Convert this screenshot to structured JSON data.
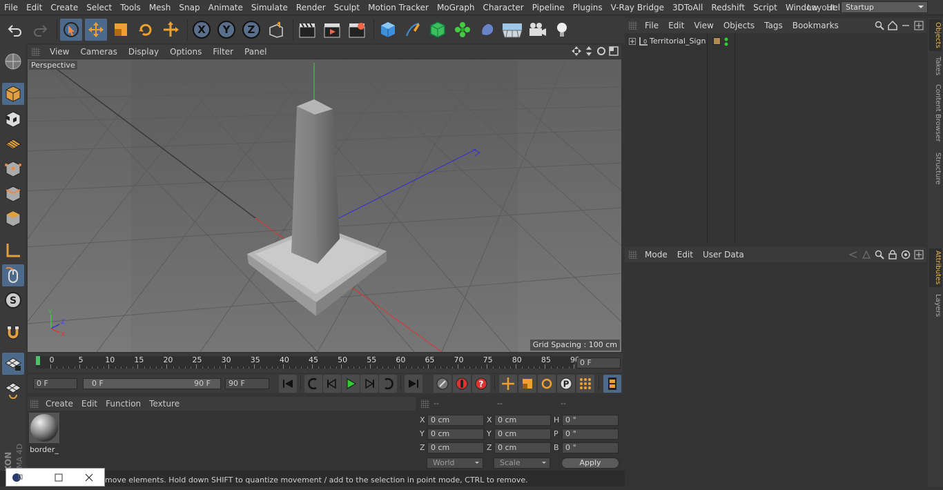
{
  "menu": [
    "File",
    "Edit",
    "Create",
    "Select",
    "Tools",
    "Mesh",
    "Snap",
    "Animate",
    "Simulate",
    "Render",
    "Sculpt",
    "Motion Tracker",
    "MoGraph",
    "Character",
    "Pipeline",
    "Plugins",
    "V-Ray Bridge",
    "3DToAll",
    "Redshift",
    "Script",
    "Window",
    "Help"
  ],
  "layout": {
    "label": "Layout:",
    "value": "Startup"
  },
  "viewport": {
    "menu": [
      "View",
      "Cameras",
      "Display",
      "Options",
      "Filter",
      "Panel"
    ],
    "name": "Perspective",
    "grid_spacing": "Grid Spacing : 100 cm",
    "axis": {
      "x": "X",
      "y": "Y",
      "z": "Z"
    }
  },
  "timeline": {
    "ticks": [
      "0",
      "5",
      "10",
      "15",
      "20",
      "25",
      "30",
      "35",
      "40",
      "45",
      "50",
      "55",
      "60",
      "65",
      "70",
      "75",
      "80",
      "85",
      "90"
    ],
    "current_frame": "0 F",
    "start_field": "0 F",
    "range_start": "0 F",
    "range_end": "90 F",
    "end_field": "90 F"
  },
  "material": {
    "menu": [
      "Create",
      "Edit",
      "Function",
      "Texture"
    ],
    "items": [
      {
        "name": "border_"
      }
    ]
  },
  "coords": {
    "headers": [
      "--",
      "--",
      "--"
    ],
    "pos": {
      "x": "0 cm",
      "y": "0 cm",
      "z": "0 cm"
    },
    "size": {
      "x": "0 cm",
      "y": "0 cm",
      "z": "0 cm"
    },
    "rot": {
      "h": "0 °",
      "p": "0 °",
      "b": "0 °"
    },
    "labels": {
      "x": "X",
      "y": "Y",
      "z": "Z",
      "h": "H",
      "p": "P",
      "b": "B"
    },
    "world": "World",
    "scale": "Scale",
    "apply": "Apply"
  },
  "status": "move elements. Hold down SHIFT to quantize movement / add to the selection in point mode, CTRL to remove.",
  "objects": {
    "menu": [
      "File",
      "Edit",
      "View",
      "Objects",
      "Tags",
      "Bookmarks"
    ],
    "items": [
      {
        "name": "Territorial_Sign"
      }
    ]
  },
  "attributes": {
    "menu": [
      "Mode",
      "Edit",
      "User Data"
    ]
  },
  "right_tabs": [
    "Objects",
    "Takes",
    "Content Browser",
    "Structure",
    "Attributes",
    "Layers"
  ],
  "brand": {
    "line1": "MAXON",
    "line2": "CINEMA 4D"
  },
  "colors": {
    "accent": "#4d6a8a",
    "highlight": "#e8b84a",
    "x_axis": "#d33",
    "y_axis": "#3c3",
    "z_axis": "#33c"
  }
}
